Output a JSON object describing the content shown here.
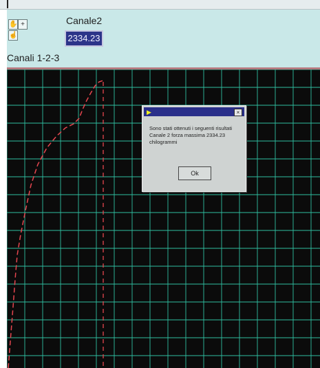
{
  "panel": {
    "channel_label": "Canale2",
    "channel_value": "2334.23",
    "channels_label": "Canali 1-2-3",
    "toolbar": [
      {
        "icon": "hand-icon",
        "glyph": "✋"
      },
      {
        "icon": "plus-icon",
        "glyph": "+"
      },
      {
        "icon": "pointer-icon",
        "glyph": "☝"
      }
    ]
  },
  "dialog": {
    "title": "",
    "close_glyph": "×",
    "message_line1": "Sono stati ottenuti i seguenti risultati",
    "message_line2": "Canale 2 forza massima 2334.23 chilogrammi",
    "ok_label": "Ok"
  },
  "colors": {
    "grid": "#2fbfa2",
    "trace": "#e7464f",
    "background": "#0b0b0b",
    "panel": "#c9e8e8",
    "titlebar": "#2a2f8a"
  }
}
